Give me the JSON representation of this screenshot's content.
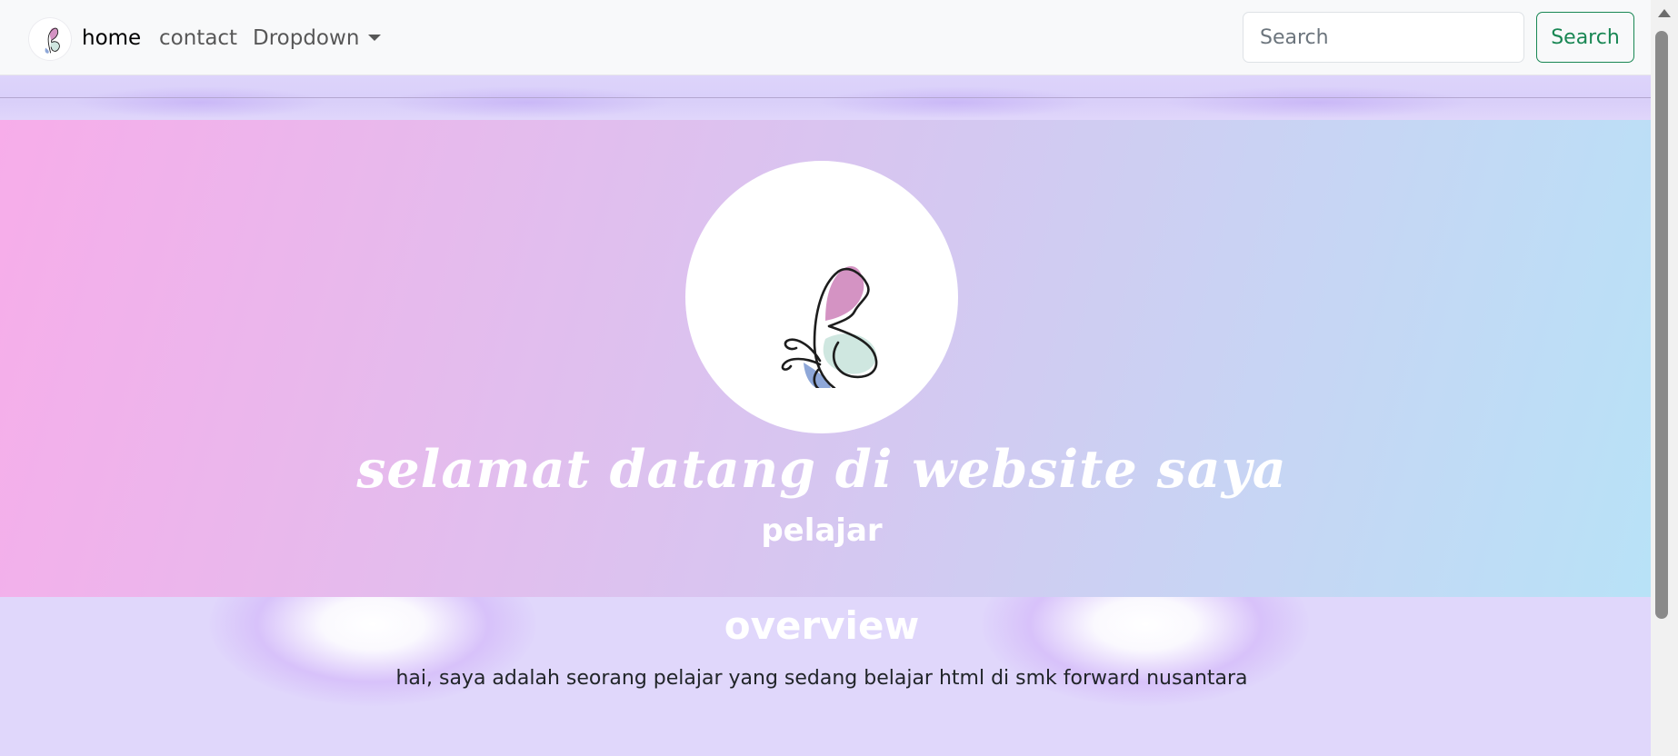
{
  "navbar": {
    "logo_icon": "butterfly-icon",
    "links": [
      {
        "label": "home",
        "active": true
      },
      {
        "label": "contact",
        "active": false
      },
      {
        "label": "Dropdown",
        "active": false
      }
    ],
    "search": {
      "placeholder": "Search",
      "value": "",
      "button_label": "Search"
    },
    "colors": {
      "background": "#f8f9fa",
      "search_button": "#198754"
    }
  },
  "hero": {
    "avatar_icon": "butterfly-icon",
    "title": "selamat datang di website saya",
    "subtitle": "pelajar",
    "gradient": [
      "#f7adea",
      "#d4c8f1",
      "#b8e2f7"
    ]
  },
  "overview": {
    "title": "overview",
    "text": "hai, saya adalah seorang pelajar yang sedang belajar html di smk forward nusantara"
  }
}
